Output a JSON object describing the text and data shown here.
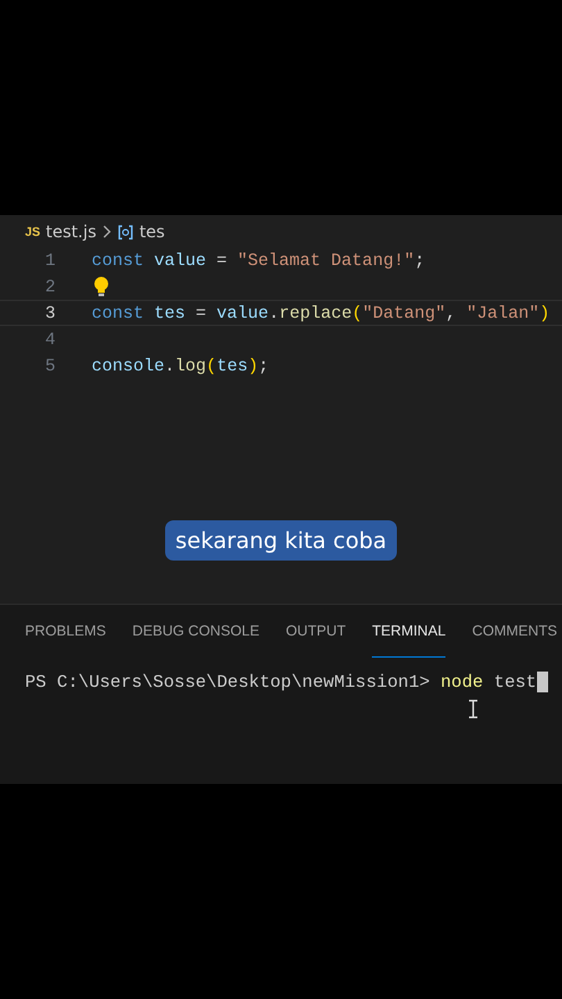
{
  "breadcrumb": {
    "file_badge": "JS",
    "file": "test.js",
    "symbol": "tes"
  },
  "editor": {
    "lines": [
      {
        "number": "1",
        "current": false,
        "lightbulb": false,
        "tokens": [
          {
            "text": "const ",
            "kind": "keyword"
          },
          {
            "text": "value",
            "kind": "variable"
          },
          {
            "text": " = ",
            "kind": "plain"
          },
          {
            "text": "\"Selamat Datang!\"",
            "kind": "string"
          },
          {
            "text": ";",
            "kind": "plain"
          }
        ]
      },
      {
        "number": "2",
        "current": false,
        "lightbulb": true
      },
      {
        "number": "3",
        "current": true,
        "lightbulb": false,
        "tokens": [
          {
            "text": "const ",
            "kind": "keyword"
          },
          {
            "text": "tes",
            "kind": "variable"
          },
          {
            "text": " = ",
            "kind": "plain"
          },
          {
            "text": "value",
            "kind": "variable"
          },
          {
            "text": ".",
            "kind": "plain"
          },
          {
            "text": "replace",
            "kind": "function"
          },
          {
            "text": "(",
            "kind": "bracket"
          },
          {
            "text": "\"Datang\"",
            "kind": "string"
          },
          {
            "text": ", ",
            "kind": "plain"
          },
          {
            "text": "\"Jalan\"",
            "kind": "string"
          },
          {
            "text": ")",
            "kind": "bracket"
          }
        ]
      },
      {
        "number": "4",
        "current": false,
        "lightbulb": false
      },
      {
        "number": "5",
        "current": false,
        "lightbulb": false,
        "tokens": [
          {
            "text": "console",
            "kind": "variable"
          },
          {
            "text": ".",
            "kind": "plain"
          },
          {
            "text": "log",
            "kind": "function"
          },
          {
            "text": "(",
            "kind": "bracket"
          },
          {
            "text": "tes",
            "kind": "variable"
          },
          {
            "text": ")",
            "kind": "bracket"
          },
          {
            "text": ";",
            "kind": "plain"
          }
        ]
      }
    ]
  },
  "caption": "sekarang kita coba",
  "panel": {
    "tabs": [
      {
        "label": "PROBLEMS",
        "selected": false
      },
      {
        "label": "DEBUG CONSOLE",
        "selected": false
      },
      {
        "label": "OUTPUT",
        "selected": false
      },
      {
        "label": "TERMINAL",
        "selected": true
      },
      {
        "label": "COMMENTS",
        "selected": false
      }
    ],
    "terminal": {
      "prompt": "PS C:\\Users\\Sosse\\Desktop\\newMission1> ",
      "command": "node",
      "argument": " test"
    }
  }
}
